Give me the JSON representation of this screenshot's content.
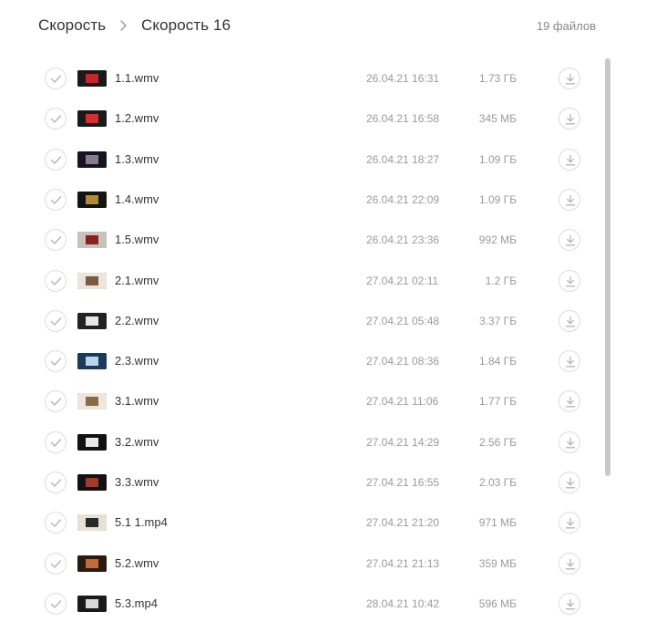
{
  "breadcrumb": {
    "root": "Скорость",
    "current": "Скорость 16",
    "separator_icon": "chevron-right-icon"
  },
  "file_count": "19 файлов",
  "icons": {
    "select": "check-circle-icon",
    "download": "download-icon"
  },
  "files": [
    {
      "name": "1.1.wmv",
      "date": "26.04.21 16:31",
      "size": "1.73 ГБ",
      "thumb": [
        "#1a1a1a",
        "#c0282d"
      ]
    },
    {
      "name": "1.2.wmv",
      "date": "26.04.21 16:58",
      "size": "345 МБ",
      "thumb": [
        "#1a1a1a",
        "#d32f2f"
      ]
    },
    {
      "name": "1.3.wmv",
      "date": "26.04.21 18:27",
      "size": "1.09 ГБ",
      "thumb": [
        "#151520",
        "#8a7a90"
      ]
    },
    {
      "name": "1.4.wmv",
      "date": "26.04.21 22:09",
      "size": "1.09 ГБ",
      "thumb": [
        "#141414",
        "#b08a3a"
      ]
    },
    {
      "name": "1.5.wmv",
      "date": "26.04.21 23:36",
      "size": "992 МБ",
      "thumb": [
        "#c8c2bc",
        "#8c1f1f"
      ]
    },
    {
      "name": "2.1.wmv",
      "date": "27.04.21 02:11",
      "size": "1.2 ГБ",
      "thumb": [
        "#e9e4dc",
        "#7a5a40"
      ]
    },
    {
      "name": "2.2.wmv",
      "date": "27.04.21 05:48",
      "size": "3.37 ГБ",
      "thumb": [
        "#222222",
        "#e6e6e6"
      ]
    },
    {
      "name": "2.3.wmv",
      "date": "27.04.21 08:36",
      "size": "1.84 ГБ",
      "thumb": [
        "#1c3a5a",
        "#b9d3ea"
      ]
    },
    {
      "name": "3.1.wmv",
      "date": "27.04.21 11:06",
      "size": "1.77 ГБ",
      "thumb": [
        "#ece6dc",
        "#8a6a4a"
      ]
    },
    {
      "name": "3.2.wmv",
      "date": "27.04.21 14:29",
      "size": "2.56 ГБ",
      "thumb": [
        "#111111",
        "#e8e8e8"
      ]
    },
    {
      "name": "3.3.wmv",
      "date": "27.04.21 16:55",
      "size": "2.03 ГБ",
      "thumb": [
        "#121212",
        "#a33a2a"
      ]
    },
    {
      "name": "5.1 1.mp4",
      "date": "27.04.21 21:20",
      "size": "971 МБ",
      "thumb": [
        "#e7e1d8",
        "#2a2a2a"
      ]
    },
    {
      "name": "5.2.wmv",
      "date": "27.04.21 21:13",
      "size": "359 МБ",
      "thumb": [
        "#2a1a14",
        "#c06a3a"
      ]
    },
    {
      "name": "5.3.mp4",
      "date": "28.04.21 10:42",
      "size": "596 МБ",
      "thumb": [
        "#1a1a1a",
        "#d8d8d8"
      ]
    }
  ]
}
